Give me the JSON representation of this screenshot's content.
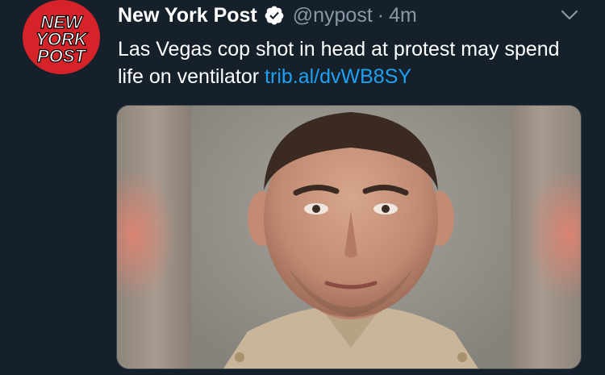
{
  "account": {
    "display_name": "New York Post",
    "handle": "@nypost",
    "separator": "·",
    "timestamp": "4m",
    "verified": true,
    "avatar_logo_lines": [
      "NEW",
      "YORK",
      "POST"
    ]
  },
  "tweet": {
    "text": "Las Vegas cop shot in head at protest may spend life on ventilator ",
    "link_text": "trib.al/dvWB8SY"
  },
  "icons": {
    "verified": "verified-badge-icon",
    "menu": "chevron-down-icon"
  },
  "colors": {
    "background": "#15202b",
    "primary_text": "#ffffff",
    "secondary_text": "#8899a6",
    "link": "#1da1f2",
    "avatar_red": "#d6232a"
  }
}
